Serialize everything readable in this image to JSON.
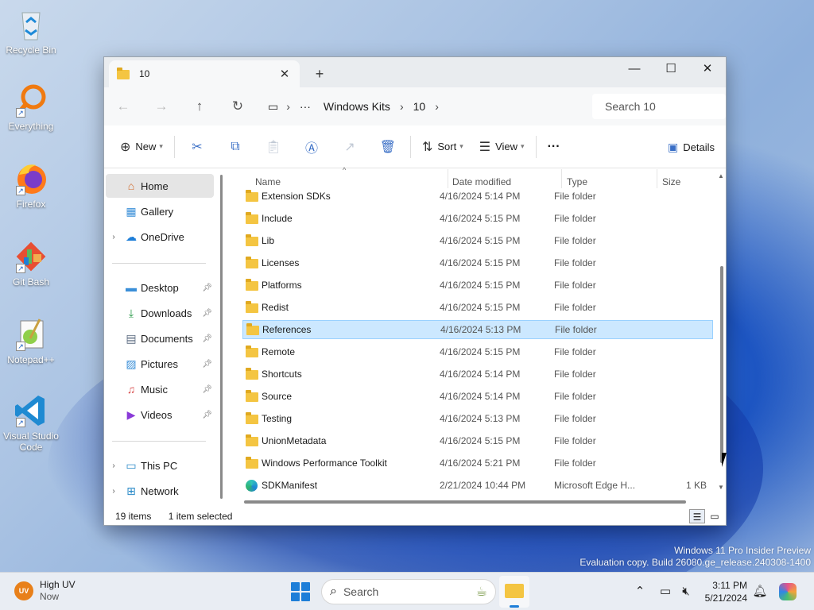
{
  "desktop": {
    "icons": [
      {
        "label": "Recycle Bin"
      },
      {
        "label": "Everything"
      },
      {
        "label": "Firefox"
      },
      {
        "label": "Git Bash"
      },
      {
        "label": "Notepad++"
      },
      {
        "label": "Visual Studio Code"
      }
    ],
    "watermark": {
      "line1": "Windows 11 Pro Insider Preview",
      "line2": "Evaluation copy. Build 26080.ge_release.240308-1400"
    }
  },
  "window": {
    "tab_title": "10",
    "tab_close": "✕",
    "new_tab": "+",
    "controls": {
      "minimize": "—",
      "maximize": "☐",
      "close": "✕"
    },
    "breadcrumb": {
      "more": "···",
      "items": [
        "Windows Kits",
        "10"
      ]
    },
    "search_placeholder": "Search 10",
    "commandbar": {
      "new_label": "New",
      "sort_label": "Sort",
      "view_label": "View",
      "more": "···",
      "details_label": "Details"
    },
    "nav": {
      "home": "Home",
      "gallery": "Gallery",
      "onedrive": "OneDrive",
      "desktop": "Desktop",
      "downloads": "Downloads",
      "documents": "Documents",
      "pictures": "Pictures",
      "music": "Music",
      "videos": "Videos",
      "thispc": "This PC",
      "network": "Network"
    },
    "columns": {
      "name": "Name",
      "date": "Date modified",
      "type": "Type",
      "size": "Size"
    },
    "files": [
      {
        "name": "Extension SDKs",
        "date": "4/16/2024 5:14 PM",
        "type": "File folder",
        "size": ""
      },
      {
        "name": "Include",
        "date": "4/16/2024 5:15 PM",
        "type": "File folder",
        "size": ""
      },
      {
        "name": "Lib",
        "date": "4/16/2024 5:15 PM",
        "type": "File folder",
        "size": ""
      },
      {
        "name": "Licenses",
        "date": "4/16/2024 5:15 PM",
        "type": "File folder",
        "size": ""
      },
      {
        "name": "Platforms",
        "date": "4/16/2024 5:15 PM",
        "type": "File folder",
        "size": ""
      },
      {
        "name": "Redist",
        "date": "4/16/2024 5:15 PM",
        "type": "File folder",
        "size": ""
      },
      {
        "name": "References",
        "date": "4/16/2024 5:13 PM",
        "type": "File folder",
        "size": ""
      },
      {
        "name": "Remote",
        "date": "4/16/2024 5:15 PM",
        "type": "File folder",
        "size": ""
      },
      {
        "name": "Shortcuts",
        "date": "4/16/2024 5:14 PM",
        "type": "File folder",
        "size": ""
      },
      {
        "name": "Source",
        "date": "4/16/2024 5:14 PM",
        "type": "File folder",
        "size": ""
      },
      {
        "name": "Testing",
        "date": "4/16/2024 5:13 PM",
        "type": "File folder",
        "size": ""
      },
      {
        "name": "UnionMetadata",
        "date": "4/16/2024 5:15 PM",
        "type": "File folder",
        "size": ""
      },
      {
        "name": "Windows Performance Toolkit",
        "date": "4/16/2024 5:21 PM",
        "type": "File folder",
        "size": ""
      },
      {
        "name": "SDKManifest",
        "date": "2/21/2024 10:44 PM",
        "type": "Microsoft Edge H...",
        "size": "1 KB"
      }
    ],
    "status": {
      "count": "19 items",
      "selected": "1 item selected"
    }
  },
  "taskbar": {
    "weather": {
      "badge": "UV",
      "title": "High UV",
      "subtitle": "Now"
    },
    "search_label": "Search",
    "time": "3:11 PM",
    "date": "5/21/2024"
  },
  "colors": {
    "accent": "#1e7ed8",
    "selection": "#cce8ff",
    "folder": "#f4c542"
  }
}
